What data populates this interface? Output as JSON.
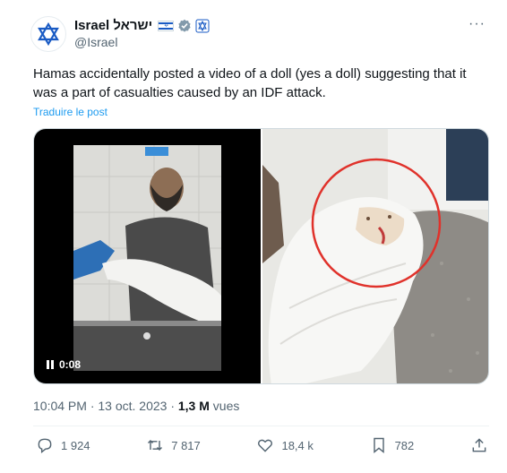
{
  "author": {
    "name": "Israel ישראל",
    "handle": "@Israel",
    "flag_icon": "israel-flag-icon",
    "verified_icon": "gray-verified-badge-icon",
    "affiliate_icon": "government-affiliate-icon"
  },
  "tweet": {
    "text": "Hamas accidentally posted a video of a doll (yes a doll) suggesting that it was a part of casualties caused by an IDF attack.",
    "translate_label": "Traduire le post",
    "video_time": "0:08",
    "time": "10:04 PM · 13 oct. 2023 · ",
    "views_count": "1,3 M",
    "views_label": " vues"
  },
  "actions": {
    "replies": "1 924",
    "reposts": "7 817",
    "likes": "18,4 k",
    "bookmarks": "782"
  },
  "colors": {
    "accent": "#1d9bf0",
    "muted": "#536471",
    "annotation_circle": "#e0322b"
  }
}
